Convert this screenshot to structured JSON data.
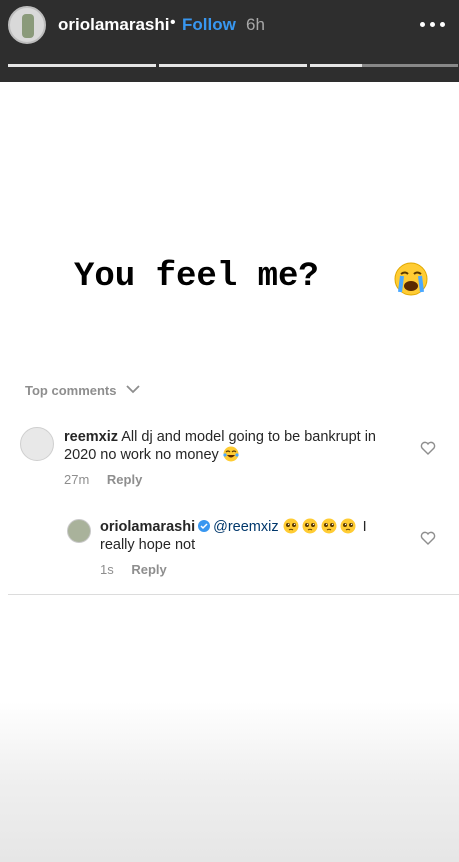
{
  "header": {
    "username": "oriolamarashi",
    "separator": "•",
    "follow_label": "Follow",
    "time": "6h"
  },
  "story": {
    "headline": "You feel me?",
    "emoji": "loudly-crying-face-emoji"
  },
  "comments_section": {
    "label": "Top comments",
    "comments": [
      {
        "user": "reemxiz",
        "text": "All dj and model going to be bankrupt in 2020 no work no money",
        "emoji": "tears-of-joy-emoji",
        "time": "27m",
        "reply_label": "Reply"
      },
      {
        "user": "oriolamarashi",
        "verified": true,
        "mention": "@reemxiz",
        "emojis": [
          "pleading-face-emoji",
          "pleading-face-emoji",
          "pleading-face-emoji",
          "pleading-face-emoji"
        ],
        "text": "I really hope not",
        "time": "1s",
        "reply_label": "Reply"
      }
    ]
  },
  "colors": {
    "header_bg": "#2e2e2e",
    "follow": "#3897f0",
    "verified": "#3897f0",
    "mention": "#00376b",
    "meta": "#8e8e8e"
  }
}
